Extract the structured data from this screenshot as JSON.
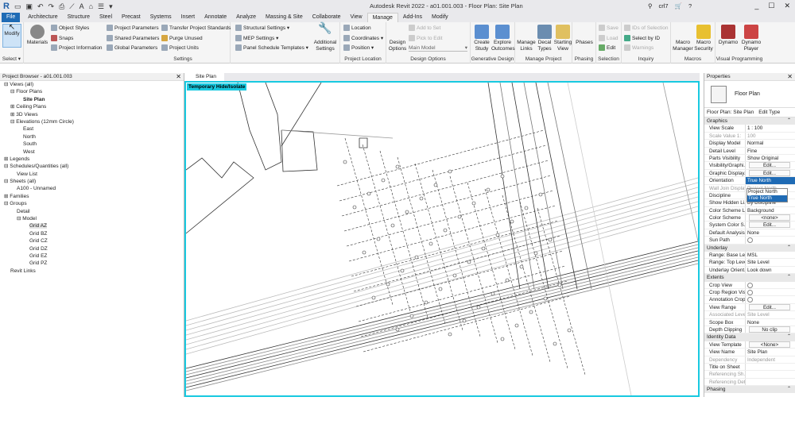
{
  "titlebar": {
    "title": "Autodesk Revit 2022 - a01.001.003 - Floor Plan: Site Plan",
    "user": "crl7"
  },
  "tabs": [
    "File",
    "Architecture",
    "Structure",
    "Steel",
    "Precast",
    "Systems",
    "Insert",
    "Annotate",
    "Analyze",
    "Massing & Site",
    "Collaborate",
    "View",
    "Manage",
    "Add-Ins",
    "Modify"
  ],
  "ribbon": {
    "select": {
      "modify": "Modify",
      "label": "Select ▾"
    },
    "settings": {
      "materials": "Materials",
      "object_styles": "Object Styles",
      "snaps": "Snaps",
      "project_information": "Project Information",
      "project_parameters": "Project Parameters",
      "shared_parameters": "Shared Parameters",
      "global_parameters": "Global Parameters",
      "transfer": "Transfer Project Standards",
      "purge": "Purge Unused",
      "project_units": "Project Units",
      "structural": "Structural Settings ▾",
      "mep": "MEP Settings ▾",
      "panel_schedule": "Panel Schedule Templates ▾",
      "additional": "Additional Settings",
      "label": "Settings"
    },
    "project_location": {
      "location": "Location",
      "coordinates": "Coordinates ▾",
      "position": "Position ▾",
      "label": "Project Location"
    },
    "design_options": {
      "design_options": "Design Options",
      "add_to_set": "Add to Set",
      "pick_to_edit": "Pick to Edit",
      "main_model": "Main Model",
      "label": "Design Options"
    },
    "generative": {
      "create": "Create Study",
      "explore": "Explore Outcomes",
      "label": "Generative Design"
    },
    "manage_project": {
      "links": "Manage Links",
      "decal": "Decal Types",
      "starting": "Starting View",
      "label": "Manage Project"
    },
    "phasing": {
      "phases": "Phases",
      "label": "Phasing"
    },
    "selection": {
      "save": "Save",
      "load": "Load",
      "edit": "Edit",
      "label": "Selection"
    },
    "inquiry": {
      "ids": "IDs of Selection",
      "select_by_id": "Select by ID",
      "warnings": "Warnings",
      "label": "Inquiry"
    },
    "macros": {
      "manager": "Macro Manager",
      "security": "Macro Security",
      "label": "Macros"
    },
    "visual": {
      "dynamo": "Dynamo",
      "player": "Dynamo Player",
      "label": "Visual Programming"
    }
  },
  "project_browser": {
    "title": "Project Browser - a01.001.003",
    "items": [
      {
        "t": "⊟ Views (all)",
        "l": 0
      },
      {
        "t": "⊟ Floor Plans",
        "l": 1
      },
      {
        "t": "Site Plan",
        "l": 3,
        "b": true
      },
      {
        "t": "⊞ Ceiling Plans",
        "l": 1
      },
      {
        "t": "⊞ 3D Views",
        "l": 1
      },
      {
        "t": "⊟ Elevations (12mm Circle)",
        "l": 1
      },
      {
        "t": "East",
        "l": 3
      },
      {
        "t": "North",
        "l": 3
      },
      {
        "t": "South",
        "l": 3
      },
      {
        "t": "West",
        "l": 3
      },
      {
        "t": "⊞ Legends",
        "l": 0
      },
      {
        "t": "⊟ Schedules/Quantities (all)",
        "l": 0
      },
      {
        "t": "View List",
        "l": 2
      },
      {
        "t": "⊟ Sheets (all)",
        "l": 0
      },
      {
        "t": "A100 - Unnamed",
        "l": 2
      },
      {
        "t": "⊞ Families",
        "l": 0
      },
      {
        "t": "⊟ Groups",
        "l": 0
      },
      {
        "t": "Detail",
        "l": 2
      },
      {
        "t": "⊟ Model",
        "l": 2
      },
      {
        "t": "Grid AZ",
        "l": 4,
        "s": true
      },
      {
        "t": "Grid BZ",
        "l": 4
      },
      {
        "t": "Grid CZ",
        "l": 4
      },
      {
        "t": "Grid DZ",
        "l": 4
      },
      {
        "t": "Grid EZ",
        "l": 4
      },
      {
        "t": "Grid PZ",
        "l": 4
      },
      {
        "t": "Revit Links",
        "l": 1
      }
    ]
  },
  "view": {
    "tab": "Site Plan",
    "badge": "Temporary Hide/Isolate"
  },
  "properties": {
    "title": "Properties",
    "type": "Floor Plan",
    "selector": "Floor Plan: Site Plan",
    "edit_type": "Edit Type",
    "sections": [
      {
        "name": "Graphics",
        "rows": [
          [
            "View Scale",
            "1 : 100"
          ],
          [
            "Scale Value 1:",
            "100",
            "g"
          ],
          [
            "Display Model",
            "Normal"
          ],
          [
            "Detail Level",
            "Fine"
          ],
          [
            "Parts Visibility",
            "Show Original"
          ],
          [
            "Visibility/Graphi...",
            "Edit...",
            "b"
          ],
          [
            "Graphic Display...",
            "Edit...",
            "b"
          ],
          [
            "Orientation",
            "True North"
          ],
          [
            "Wall Join Display",
            "Project North",
            "g"
          ],
          [
            "Discipline",
            "True North"
          ],
          [
            "Show Hidden Li...",
            "By Discipline"
          ],
          [
            "Color Scheme L...",
            "Background"
          ],
          [
            "Color Scheme",
            "<none>",
            "b"
          ],
          [
            "System Color S...",
            "Edit...",
            "b"
          ],
          [
            "Default Analysis...",
            "None"
          ],
          [
            "Sun Path",
            "",
            "c"
          ]
        ]
      },
      {
        "name": "Underlay",
        "rows": [
          [
            "Range: Base Level",
            "MSL"
          ],
          [
            "Range: Top Level",
            "Site Level"
          ],
          [
            "Underlay Orient...",
            "Look down"
          ]
        ]
      },
      {
        "name": "Extents",
        "rows": [
          [
            "Crop View",
            "",
            "c"
          ],
          [
            "Crop Region Vis...",
            "",
            "c"
          ],
          [
            "Annotation Crop",
            "",
            "c"
          ],
          [
            "View Range",
            "Edit...",
            "b"
          ],
          [
            "Associated Level",
            "Site Level",
            "g"
          ],
          [
            "Scope Box",
            "None"
          ],
          [
            "Depth Clipping",
            "No clip",
            "b"
          ]
        ]
      },
      {
        "name": "Identity Data",
        "rows": [
          [
            "View Template",
            "<None>",
            "b"
          ],
          [
            "View Name",
            "Site Plan"
          ],
          [
            "Dependency",
            "Independent",
            "g"
          ],
          [
            "Title on Sheet",
            ""
          ],
          [
            "Referencing Sh...",
            "",
            "g"
          ],
          [
            "Referencing Det...",
            "",
            "g"
          ]
        ]
      },
      {
        "name": "Phasing",
        "rows": []
      }
    ],
    "dropdown": [
      "Project North",
      "True North"
    ]
  },
  "colors": {
    "accent": "#1f6bb5",
    "highlight": "#18c9e0"
  }
}
